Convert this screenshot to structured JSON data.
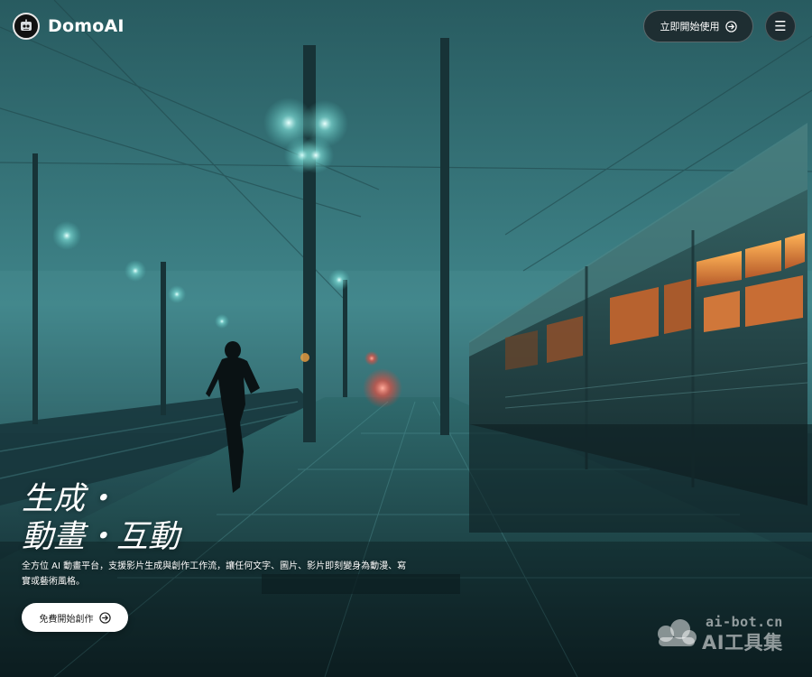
{
  "header": {
    "brand": "DomoAI",
    "cta_label": "立即開始使用",
    "cta_icon": "arrow-right-circle-icon",
    "menu_icon": "hamburger-menu-icon"
  },
  "hero": {
    "title_line1": "生成・",
    "title_line2": "動畫・互動",
    "description": "全方位 AI 動畫平台，支援影片生成與創作工作流，讓任何文字、圖片、影片即刻變身為動漫、寫實或藝術風格。",
    "cta_label": "免費開始創作",
    "cta_icon": "arrow-right-circle-icon",
    "background_image": "foggy-train-station-night-runner"
  },
  "watermark": {
    "domain": "ai-bot.cn",
    "brand": "AI工具集"
  },
  "colors": {
    "teal_fog": "#3f8489",
    "dark": "#0b1a1d",
    "window_glow": "#f09a3e",
    "button_dark": "#1c262a",
    "button_light": "#ffffff"
  }
}
